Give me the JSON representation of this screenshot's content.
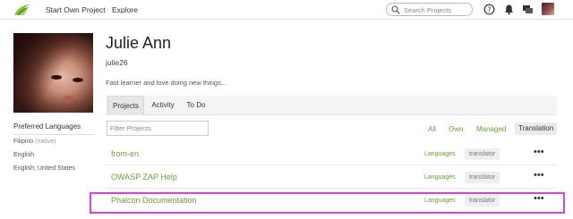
{
  "nav": {
    "start_project": "Start Own Project",
    "explore": "Explore",
    "search_placeholder": "Search Projects",
    "icons": [
      "help-icon",
      "bell-icon",
      "chat-icon"
    ]
  },
  "profile": {
    "name": "Julie Ann",
    "username": "julie26",
    "bio": "Fast learner and love doing new things..."
  },
  "preferred_languages": {
    "title": "Preferred Languages",
    "items": [
      {
        "name": "Filipino",
        "note": "(native)"
      },
      {
        "name": "English",
        "note": ""
      },
      {
        "name": "English, United States",
        "note": ""
      }
    ]
  },
  "tabs": [
    {
      "label": "Projects",
      "active": true
    },
    {
      "label": "Activity",
      "active": false
    },
    {
      "label": "To Do",
      "active": false
    }
  ],
  "filter": {
    "placeholder": "Filter Projects",
    "options": [
      {
        "label": "All",
        "active": false
      },
      {
        "label": "Own",
        "active": false
      },
      {
        "label": "Managed",
        "active": false
      },
      {
        "label": "Translation",
        "active": true
      }
    ]
  },
  "projects": [
    {
      "name": "from-en",
      "languages_label": "Languages",
      "role": "translator",
      "more": "•••"
    },
    {
      "name": "OWASP ZAP Help",
      "languages_label": "Languages",
      "role": "translator",
      "more": "•••"
    },
    {
      "name": "Phalcon Documentation",
      "languages_label": "Languages",
      "role": "translator",
      "more": "•••"
    }
  ],
  "colors": {
    "accent_green": "#6a9e3a",
    "highlight": "#e33ee3"
  }
}
